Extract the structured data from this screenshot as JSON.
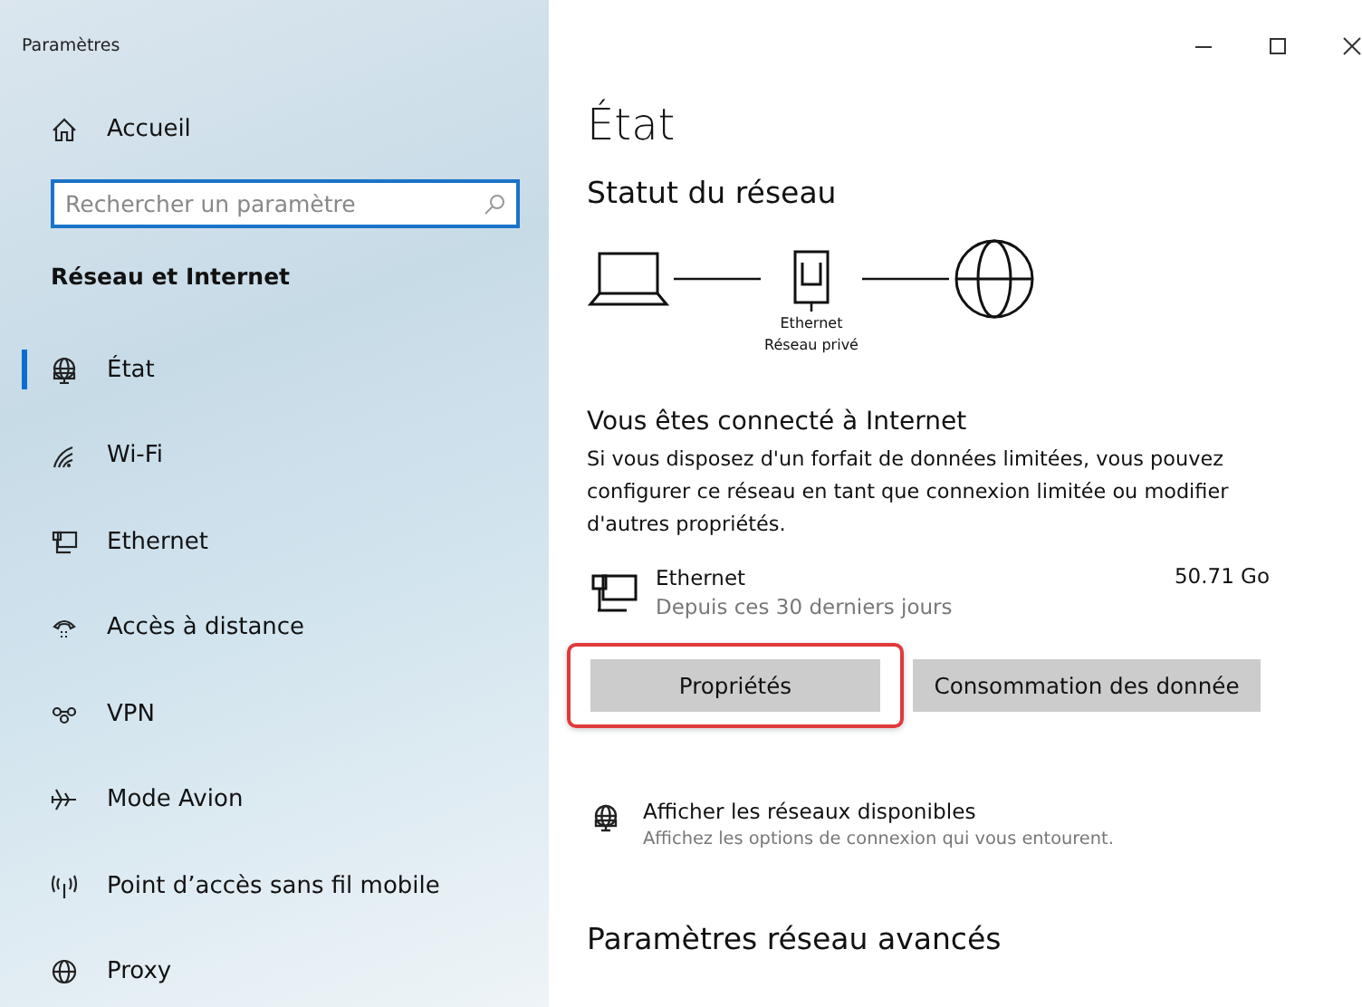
{
  "window": {
    "title": "Paramètres"
  },
  "sidebar": {
    "home": "Accueil",
    "search": {
      "placeholder": "Rechercher un paramètre"
    },
    "section": "Réseau et Internet",
    "items": [
      {
        "label": "État",
        "selected": true
      },
      {
        "label": "Wi-Fi",
        "selected": false
      },
      {
        "label": "Ethernet",
        "selected": false
      },
      {
        "label": "Accès à distance",
        "selected": false
      },
      {
        "label": "VPN",
        "selected": false
      },
      {
        "label": "Mode Avion",
        "selected": false
      },
      {
        "label": "Point d’accès sans fil mobile",
        "selected": false
      },
      {
        "label": "Proxy",
        "selected": false
      }
    ]
  },
  "main": {
    "title": "État",
    "network_status": {
      "heading": "Statut du réseau",
      "adapter": "Ethernet",
      "profile": "Réseau privé"
    },
    "connected": {
      "heading": "Vous êtes connecté à Internet",
      "text": "Si vous disposez d'un forfait de données limitées, vous pouvez configurer ce réseau en tant que connexion limitée ou modifier d'autres propriétés."
    },
    "usage": {
      "name": "Ethernet",
      "period": "Depuis ces 30 derniers jours",
      "amount": "50.71 Go"
    },
    "buttons": [
      {
        "label": "Propriétés",
        "highlighted": true
      },
      {
        "label": "Consommation des donnée",
        "highlighted": false
      }
    ],
    "show_networks": {
      "title": "Afficher les réseaux disponibles",
      "subtitle": "Affichez les options de connexion qui vous entourent."
    },
    "advanced": "Paramètres réseau avancés"
  }
}
